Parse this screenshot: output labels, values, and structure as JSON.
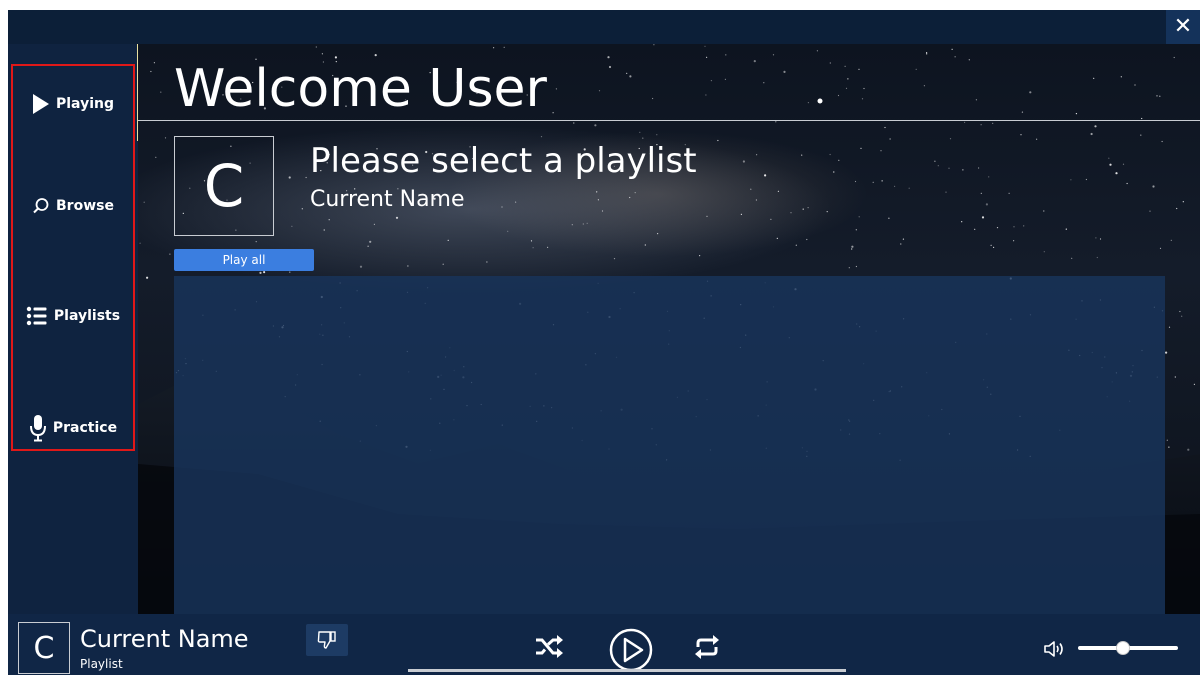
{
  "window": {
    "close_label": "✕"
  },
  "sidebar": {
    "items": [
      {
        "label": "Playing",
        "icon": "play-triangle-icon"
      },
      {
        "label": "Browse",
        "icon": "search-icon"
      },
      {
        "label": "Playlists",
        "icon": "list-icon"
      },
      {
        "label": "Practice",
        "icon": "microphone-icon"
      }
    ]
  },
  "main": {
    "welcome": "Welcome User",
    "cover_letter": "C",
    "playlist_title": "Please select a playlist",
    "playlist_subtitle": "Current Name",
    "play_all_label": "Play all"
  },
  "player": {
    "cover_letter": "C",
    "track_name": "Current Name",
    "track_sub": "Playlist",
    "volume_level": 0.45,
    "icons": [
      "thumbs-down-icon",
      "shuffle-icon",
      "play-icon",
      "repeat-icon",
      "volume-icon"
    ]
  },
  "colors": {
    "sidebar_bg": "#0f2340",
    "accent_blue": "#3b7ee0",
    "highlight_red": "#e01818",
    "panel_bg": "#18345c"
  }
}
